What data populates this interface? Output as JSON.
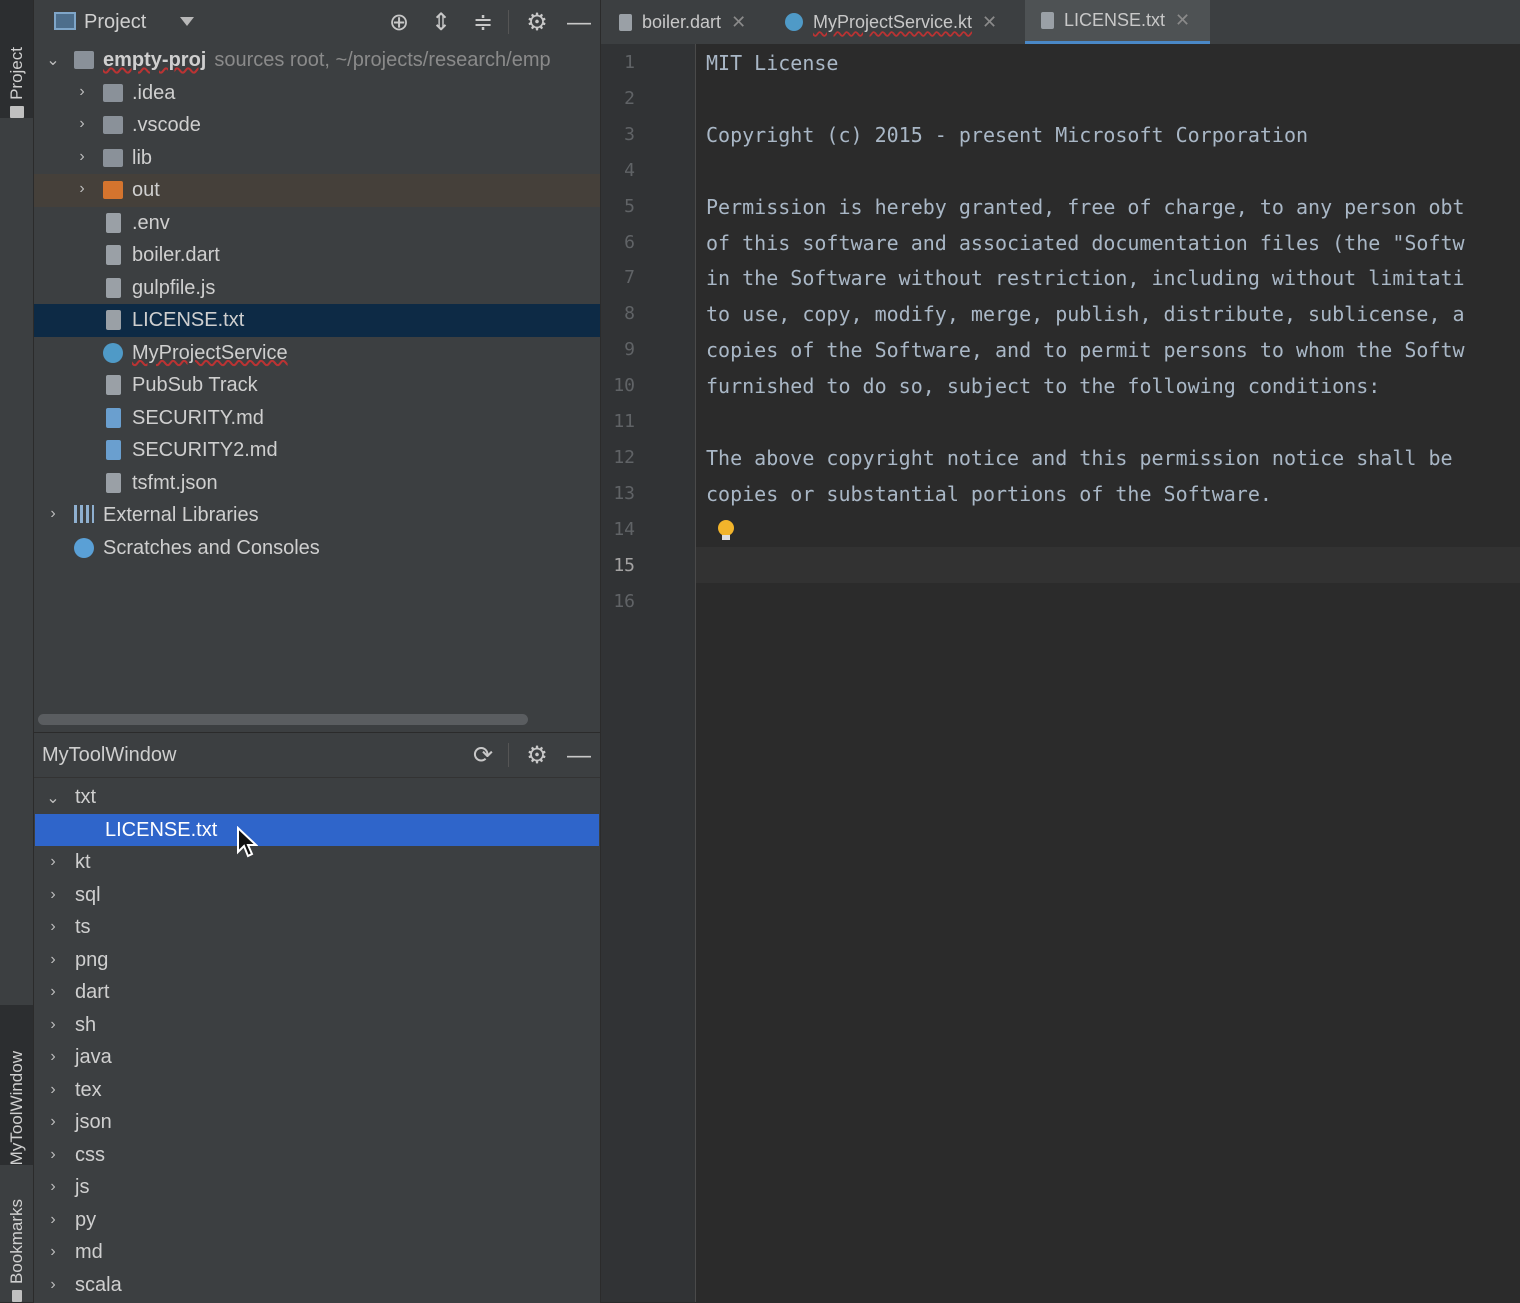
{
  "stripe": {
    "project_label": "Project",
    "mytool_label": "MyToolWindow",
    "bookmarks_label": "Bookmarks"
  },
  "project_panel": {
    "title": "Project",
    "tree": [
      {
        "label": "empty-proj",
        "sub": "sources root, ~/projects/research/emp",
        "level": 0,
        "expanded": true,
        "icon": "module-folder-icon"
      },
      {
        "label": ".idea",
        "level": 1,
        "icon": "folder-icon"
      },
      {
        "label": ".vscode",
        "level": 1,
        "icon": "folder-icon"
      },
      {
        "label": "lib",
        "level": 1,
        "icon": "folder-icon"
      },
      {
        "label": "out",
        "level": 1,
        "icon": "orange-folder-icon"
      },
      {
        "label": ".env",
        "level": 1,
        "icon": "text-file-icon"
      },
      {
        "label": "boiler.dart",
        "level": 1,
        "icon": "text-file-icon"
      },
      {
        "label": "gulpfile.js",
        "level": 1,
        "icon": "js-file-icon"
      },
      {
        "label": "LICENSE.txt",
        "level": 1,
        "icon": "text-file-icon"
      },
      {
        "label": "MyProjectService",
        "level": 1,
        "icon": "kotlin-class-icon"
      },
      {
        "label": "PubSub Track",
        "level": 1,
        "icon": "text-file-icon"
      },
      {
        "label": "SECURITY.md",
        "level": 1,
        "icon": "markdown-file-icon"
      },
      {
        "label": "SECURITY2.md",
        "level": 1,
        "icon": "markdown-file-icon"
      },
      {
        "label": "tsfmt.json",
        "level": 1,
        "icon": "json-file-icon"
      },
      {
        "label": "External Libraries",
        "level": 0,
        "icon": "libraries-icon"
      },
      {
        "label": "Scratches and Consoles",
        "level": 0,
        "icon": "scratches-icon"
      }
    ]
  },
  "tool_window": {
    "title": "MyToolWindow",
    "items": [
      "txt",
      "LICENSE.txt",
      "kt",
      "sql",
      "ts",
      "png",
      "dart",
      "sh",
      "java",
      "tex",
      "json",
      "css",
      "js",
      "py",
      "md",
      "scala"
    ]
  },
  "tabs": [
    "boiler.dart",
    "MyProjectService.kt",
    "LICENSE.txt"
  ],
  "editor": {
    "line_numbers": [
      "1",
      "2",
      "3",
      "4",
      "5",
      "6",
      "7",
      "8",
      "9",
      "10",
      "11",
      "12",
      "13",
      "14",
      "15",
      "16"
    ],
    "lines": [
      "MIT License",
      "",
      "Copyright (c) 2015 - present Microsoft Corporation",
      "",
      "Permission is hereby granted, free of charge, to any person obt",
      "of this software and associated documentation files (the \"Softw",
      "in the Software without restriction, including without limitati",
      "to use, copy, modify, merge, publish, distribute, sublicense, a",
      "copies of the Software, and to permit persons to whom the Softw",
      "furnished to do so, subject to the following conditions:",
      "",
      "The above copyright notice and this permission notice shall be",
      "copies or substantial portions of the Software.",
      "",
      "",
      ""
    ],
    "current_line": 15
  },
  "colors": {
    "selection_blue": "#2f65ca",
    "selection_dark": "#0d2a45",
    "out_folder": "#d4742e"
  }
}
